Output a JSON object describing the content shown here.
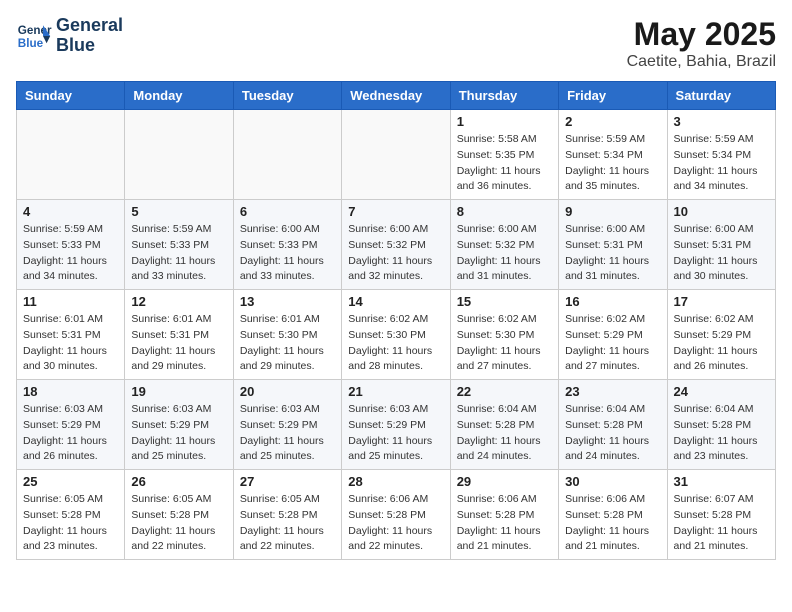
{
  "logo": {
    "line1": "General",
    "line2": "Blue"
  },
  "title": "May 2025",
  "subtitle": "Caetite, Bahia, Brazil",
  "weekdays": [
    "Sunday",
    "Monday",
    "Tuesday",
    "Wednesday",
    "Thursday",
    "Friday",
    "Saturday"
  ],
  "weeks": [
    [
      {
        "day": "",
        "info": ""
      },
      {
        "day": "",
        "info": ""
      },
      {
        "day": "",
        "info": ""
      },
      {
        "day": "",
        "info": ""
      },
      {
        "day": "1",
        "info": "Sunrise: 5:58 AM\nSunset: 5:35 PM\nDaylight: 11 hours\nand 36 minutes."
      },
      {
        "day": "2",
        "info": "Sunrise: 5:59 AM\nSunset: 5:34 PM\nDaylight: 11 hours\nand 35 minutes."
      },
      {
        "day": "3",
        "info": "Sunrise: 5:59 AM\nSunset: 5:34 PM\nDaylight: 11 hours\nand 34 minutes."
      }
    ],
    [
      {
        "day": "4",
        "info": "Sunrise: 5:59 AM\nSunset: 5:33 PM\nDaylight: 11 hours\nand 34 minutes."
      },
      {
        "day": "5",
        "info": "Sunrise: 5:59 AM\nSunset: 5:33 PM\nDaylight: 11 hours\nand 33 minutes."
      },
      {
        "day": "6",
        "info": "Sunrise: 6:00 AM\nSunset: 5:33 PM\nDaylight: 11 hours\nand 33 minutes."
      },
      {
        "day": "7",
        "info": "Sunrise: 6:00 AM\nSunset: 5:32 PM\nDaylight: 11 hours\nand 32 minutes."
      },
      {
        "day": "8",
        "info": "Sunrise: 6:00 AM\nSunset: 5:32 PM\nDaylight: 11 hours\nand 31 minutes."
      },
      {
        "day": "9",
        "info": "Sunrise: 6:00 AM\nSunset: 5:31 PM\nDaylight: 11 hours\nand 31 minutes."
      },
      {
        "day": "10",
        "info": "Sunrise: 6:00 AM\nSunset: 5:31 PM\nDaylight: 11 hours\nand 30 minutes."
      }
    ],
    [
      {
        "day": "11",
        "info": "Sunrise: 6:01 AM\nSunset: 5:31 PM\nDaylight: 11 hours\nand 30 minutes."
      },
      {
        "day": "12",
        "info": "Sunrise: 6:01 AM\nSunset: 5:31 PM\nDaylight: 11 hours\nand 29 minutes."
      },
      {
        "day": "13",
        "info": "Sunrise: 6:01 AM\nSunset: 5:30 PM\nDaylight: 11 hours\nand 29 minutes."
      },
      {
        "day": "14",
        "info": "Sunrise: 6:02 AM\nSunset: 5:30 PM\nDaylight: 11 hours\nand 28 minutes."
      },
      {
        "day": "15",
        "info": "Sunrise: 6:02 AM\nSunset: 5:30 PM\nDaylight: 11 hours\nand 27 minutes."
      },
      {
        "day": "16",
        "info": "Sunrise: 6:02 AM\nSunset: 5:29 PM\nDaylight: 11 hours\nand 27 minutes."
      },
      {
        "day": "17",
        "info": "Sunrise: 6:02 AM\nSunset: 5:29 PM\nDaylight: 11 hours\nand 26 minutes."
      }
    ],
    [
      {
        "day": "18",
        "info": "Sunrise: 6:03 AM\nSunset: 5:29 PM\nDaylight: 11 hours\nand 26 minutes."
      },
      {
        "day": "19",
        "info": "Sunrise: 6:03 AM\nSunset: 5:29 PM\nDaylight: 11 hours\nand 25 minutes."
      },
      {
        "day": "20",
        "info": "Sunrise: 6:03 AM\nSunset: 5:29 PM\nDaylight: 11 hours\nand 25 minutes."
      },
      {
        "day": "21",
        "info": "Sunrise: 6:03 AM\nSunset: 5:29 PM\nDaylight: 11 hours\nand 25 minutes."
      },
      {
        "day": "22",
        "info": "Sunrise: 6:04 AM\nSunset: 5:28 PM\nDaylight: 11 hours\nand 24 minutes."
      },
      {
        "day": "23",
        "info": "Sunrise: 6:04 AM\nSunset: 5:28 PM\nDaylight: 11 hours\nand 24 minutes."
      },
      {
        "day": "24",
        "info": "Sunrise: 6:04 AM\nSunset: 5:28 PM\nDaylight: 11 hours\nand 23 minutes."
      }
    ],
    [
      {
        "day": "25",
        "info": "Sunrise: 6:05 AM\nSunset: 5:28 PM\nDaylight: 11 hours\nand 23 minutes."
      },
      {
        "day": "26",
        "info": "Sunrise: 6:05 AM\nSunset: 5:28 PM\nDaylight: 11 hours\nand 22 minutes."
      },
      {
        "day": "27",
        "info": "Sunrise: 6:05 AM\nSunset: 5:28 PM\nDaylight: 11 hours\nand 22 minutes."
      },
      {
        "day": "28",
        "info": "Sunrise: 6:06 AM\nSunset: 5:28 PM\nDaylight: 11 hours\nand 22 minutes."
      },
      {
        "day": "29",
        "info": "Sunrise: 6:06 AM\nSunset: 5:28 PM\nDaylight: 11 hours\nand 21 minutes."
      },
      {
        "day": "30",
        "info": "Sunrise: 6:06 AM\nSunset: 5:28 PM\nDaylight: 11 hours\nand 21 minutes."
      },
      {
        "day": "31",
        "info": "Sunrise: 6:07 AM\nSunset: 5:28 PM\nDaylight: 11 hours\nand 21 minutes."
      }
    ]
  ]
}
